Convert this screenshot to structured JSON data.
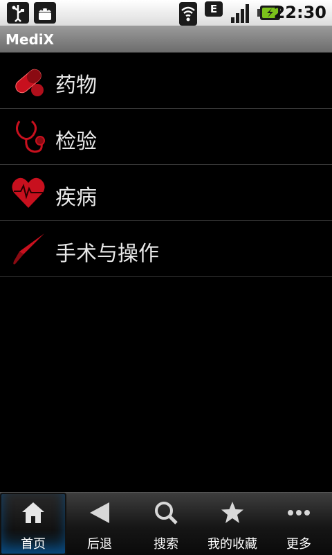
{
  "status_bar": {
    "icons": [
      "usb-icon",
      "android-debug-icon",
      "wifi-icon",
      "edge-network-icon",
      "signal-icon",
      "battery-charging-icon"
    ],
    "edge_label": "E",
    "time": "22:30"
  },
  "app": {
    "title": "MediX"
  },
  "menu": {
    "items": [
      {
        "label": "药物",
        "icon": "pill-icon"
      },
      {
        "label": "检验",
        "icon": "stethoscope-icon"
      },
      {
        "label": "疾病",
        "icon": "heart-pulse-icon"
      },
      {
        "label": "手术与操作",
        "icon": "scalpel-icon"
      }
    ]
  },
  "tabs": {
    "items": [
      {
        "label": "首页",
        "icon": "home-icon"
      },
      {
        "label": "后退",
        "icon": "back-arrow-icon"
      },
      {
        "label": "搜索",
        "icon": "search-icon"
      },
      {
        "label": "我的收藏",
        "icon": "star-icon"
      },
      {
        "label": "更多",
        "icon": "more-dots-icon"
      }
    ],
    "active": "首页"
  },
  "colors": {
    "accent_red": "#c8101e",
    "active_tab_glow": "#0a4d86"
  }
}
